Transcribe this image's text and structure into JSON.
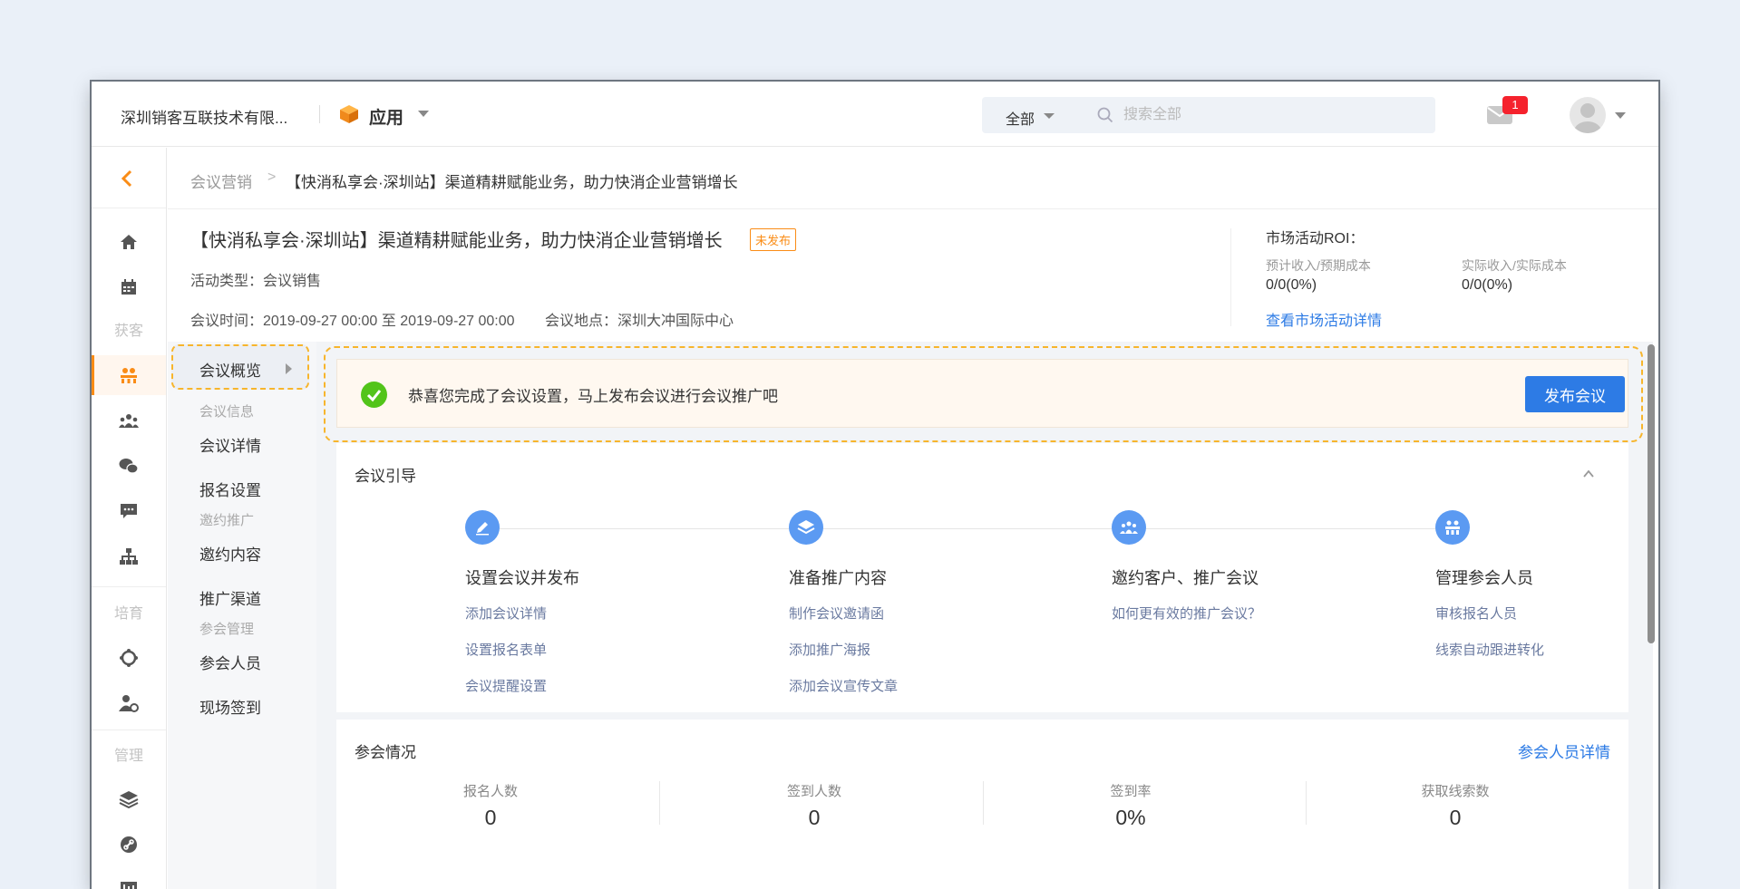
{
  "topbar": {
    "company": "深圳销客互联技术有限...",
    "app_name": "应用",
    "search_scope": "全部",
    "search_placeholder": "搜索全部",
    "mail_badge": "1"
  },
  "rail": {
    "group_acquire": "获客",
    "group_nurture": "培育",
    "group_manage": "管理",
    "icons": [
      "back-icon",
      "home-icon",
      "calendar-icon",
      "conference-icon",
      "group-icon",
      "wechat-icon",
      "message-icon",
      "org-chart-icon",
      "target-icon",
      "user-settings-icon",
      "layers-icon",
      "link-icon",
      "display-icon"
    ]
  },
  "breadcrumb": {
    "parent": "会议营销",
    "separator": ">",
    "current": "【快消私享会·深圳站】渠道精耕赋能业务，助力快消企业营销增长"
  },
  "event": {
    "title": "【快消私享会·深圳站】渠道精耕赋能业务，助力快消企业营销增长",
    "status": "未发布",
    "type": "活动类型：会议销售",
    "time": "会议时间：2019-09-27 00:00 至 2019-09-27 00:00",
    "place": "会议地点：深圳大冲国际中心"
  },
  "roi": {
    "title": "市场活动ROI：",
    "label_expected": "预计收入/预期成本",
    "value_expected": "0/0(0%)",
    "label_actual": "实际收入/实际成本",
    "value_actual": "0/0(0%)",
    "link": "查看市场活动详情"
  },
  "subnav": {
    "active": "会议概览",
    "group_info": "会议信息",
    "item_detail": "会议详情",
    "item_signup": "报名设置",
    "group_invite": "邀约推广",
    "item_invite_content": "邀约内容",
    "item_channel": "推广渠道",
    "group_attendee": "参会管理",
    "item_attendees": "参会人员",
    "item_checkin": "现场签到"
  },
  "banner": {
    "text": "恭喜您完成了会议设置，马上发布会议进行会议推广吧",
    "button": "发布会议"
  },
  "guide": {
    "title": "会议引导",
    "steps": [
      {
        "title": "设置会议并发布",
        "icon": "edit-icon",
        "links": [
          "添加会议详情",
          "设置报名表单",
          "会议提醒设置"
        ]
      },
      {
        "title": "准备推广内容",
        "icon": "layers-icon",
        "links": [
          "制作会议邀请函",
          "添加推广海报",
          "添加会议宣传文章"
        ]
      },
      {
        "title": "邀约客户、推广会议",
        "icon": "people-icon",
        "links": [
          "如何更有效的推广会议？"
        ]
      },
      {
        "title": "管理参会人员",
        "icon": "attendees-icon",
        "links": [
          "审核报名人员",
          "线索自动跟进转化"
        ]
      }
    ]
  },
  "stats": {
    "title": "参会情况",
    "link": "参会人员详情",
    "items": [
      {
        "label": "报名人数",
        "value": "0"
      },
      {
        "label": "签到人数",
        "value": "0"
      },
      {
        "label": "签到率",
        "value": "0%"
      },
      {
        "label": "获取线索数",
        "value": "0"
      }
    ]
  },
  "colors": {
    "accent_orange": "#fa8c16",
    "primary_blue": "#2d7be5",
    "step_blue": "#5b9af2",
    "success_green": "#52c41a",
    "highlight_dash": "#f7b52c"
  }
}
